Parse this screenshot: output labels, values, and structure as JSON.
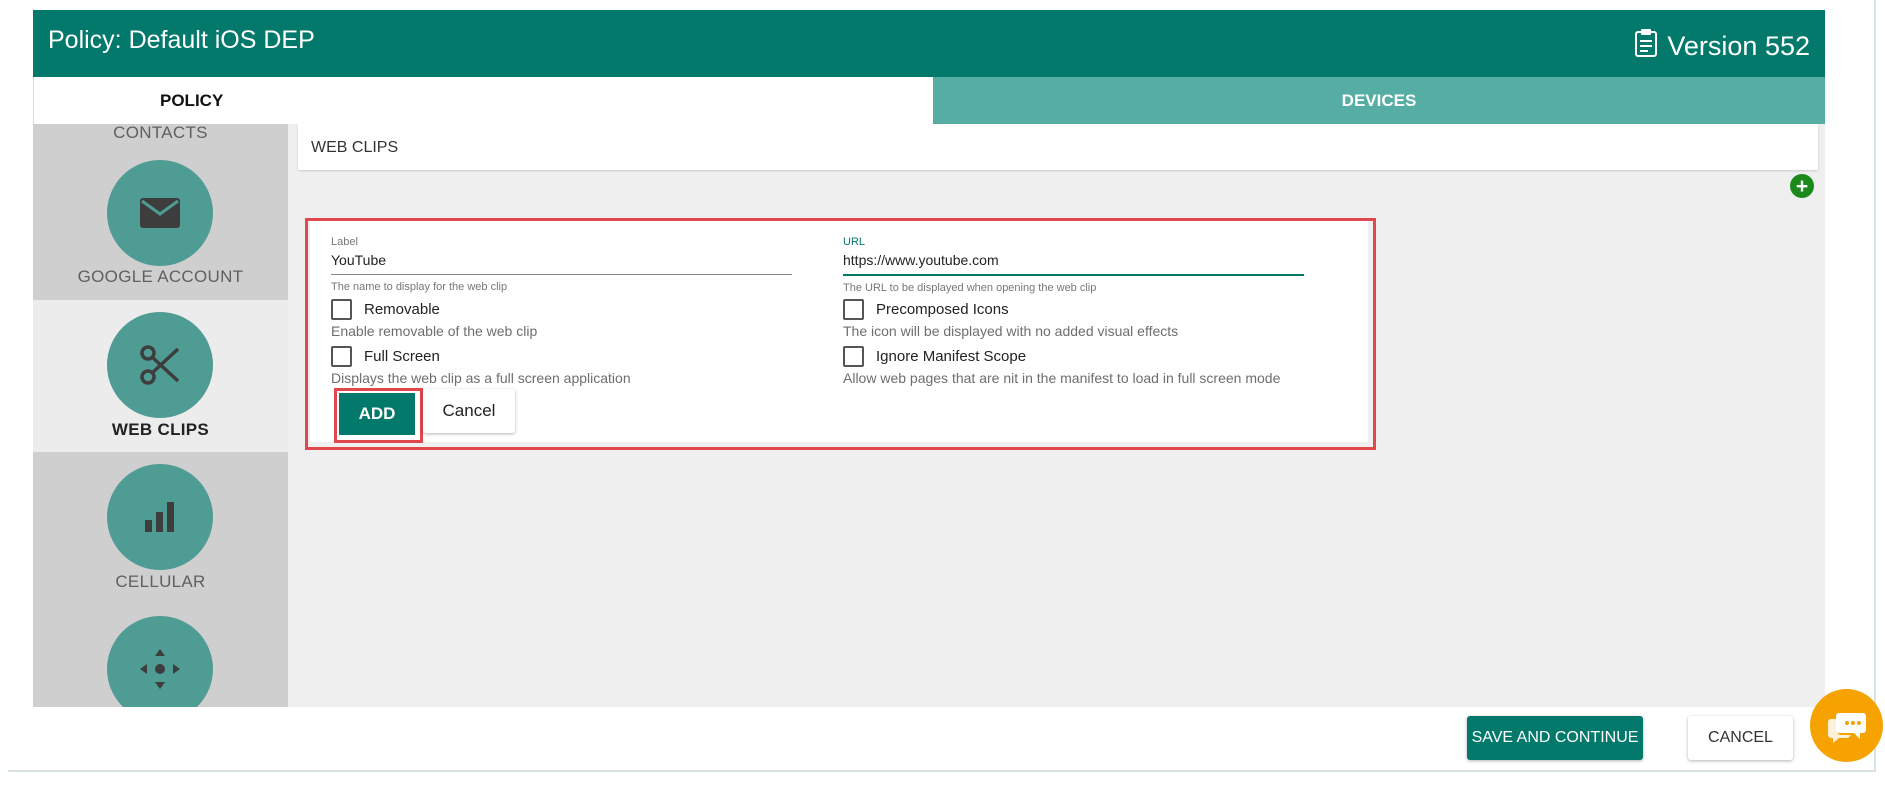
{
  "header": {
    "title": "Policy: Default iOS DEP",
    "version": "Version 552"
  },
  "tabs": [
    {
      "label": "POLICY"
    },
    {
      "label": "DEVICES"
    }
  ],
  "sidebar": {
    "items": [
      {
        "label": "CONTACTS",
        "icon": "contacts-icon"
      },
      {
        "label": "GOOGLE ACCOUNT",
        "icon": "mail-icon"
      },
      {
        "label": "WEB CLIPS",
        "icon": "scissors-icon",
        "active": true
      },
      {
        "label": "CELLULAR",
        "icon": "bar-chart-icon"
      },
      {
        "label": "",
        "icon": "move-arrows-icon"
      }
    ]
  },
  "section": {
    "title": "WEB CLIPS"
  },
  "form": {
    "label_field": {
      "label": "Label",
      "value": "YouTube",
      "hint": "The name to display for the web clip"
    },
    "url_field": {
      "label": "URL",
      "value": "https://www.youtube.com",
      "hint": "The URL to be displayed when opening the web clip"
    },
    "removable": {
      "label": "Removable",
      "desc": "Enable removable of the web clip",
      "checked": false
    },
    "full_screen": {
      "label": "Full Screen",
      "desc": "Displays the web clip as a full screen application",
      "checked": false
    },
    "precomposed": {
      "label": "Precomposed Icons",
      "desc": "The icon will be displayed with no added visual effects",
      "checked": false
    },
    "ignore_manifest": {
      "label": "Ignore Manifest Scope",
      "desc": "Allow web pages that are nit in the manifest to load in full screen mode",
      "checked": false
    },
    "add_label": "ADD",
    "cancel_label": "Cancel"
  },
  "footer": {
    "save_label": "SAVE AND CONTINUE",
    "cancel_label": "CANCEL"
  },
  "colors": {
    "primary": "#03796b",
    "tab_secondary": "#56ada4",
    "highlight": "#e0484e",
    "chat": "#f6a200"
  }
}
